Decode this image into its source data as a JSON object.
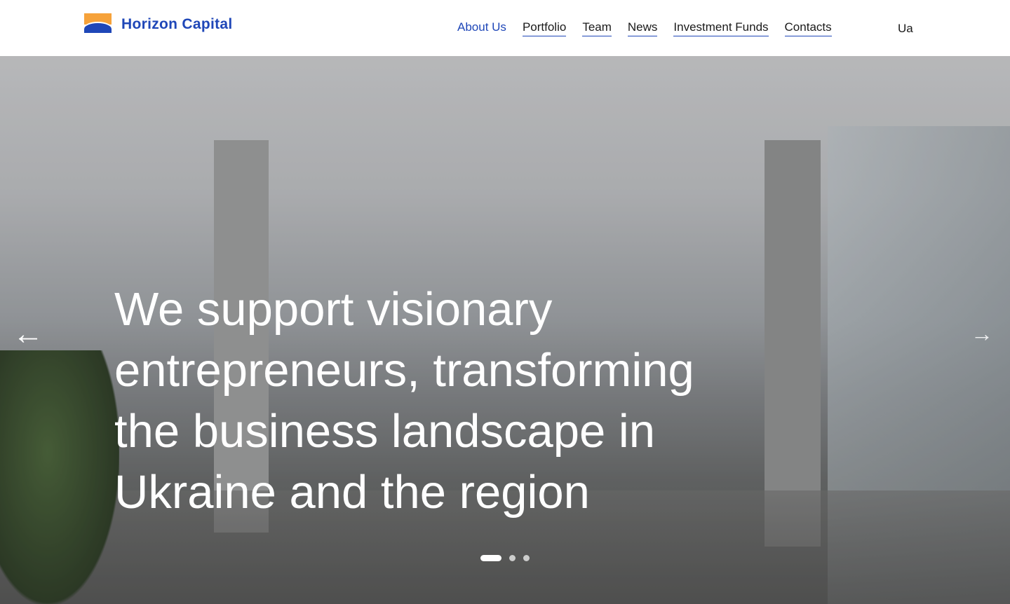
{
  "brand": {
    "name": "Horizon Capital",
    "colors": {
      "orange": "#f6a23a",
      "blue": "#1f47b8"
    }
  },
  "nav": {
    "items": [
      {
        "label": "About Us",
        "active": true
      },
      {
        "label": "Portfolio"
      },
      {
        "label": "Team"
      },
      {
        "label": "News"
      },
      {
        "label": "Investment Funds"
      },
      {
        "label": "Contacts"
      }
    ],
    "language": "Ua"
  },
  "hero": {
    "headline": "We support visionary entrepreneurs, transforming the business landscape in Ukraine and the region",
    "prev_icon": "arrow-left-icon",
    "next_icon": "arrow-right-icon",
    "slides_total": 3,
    "current_slide": 1
  }
}
